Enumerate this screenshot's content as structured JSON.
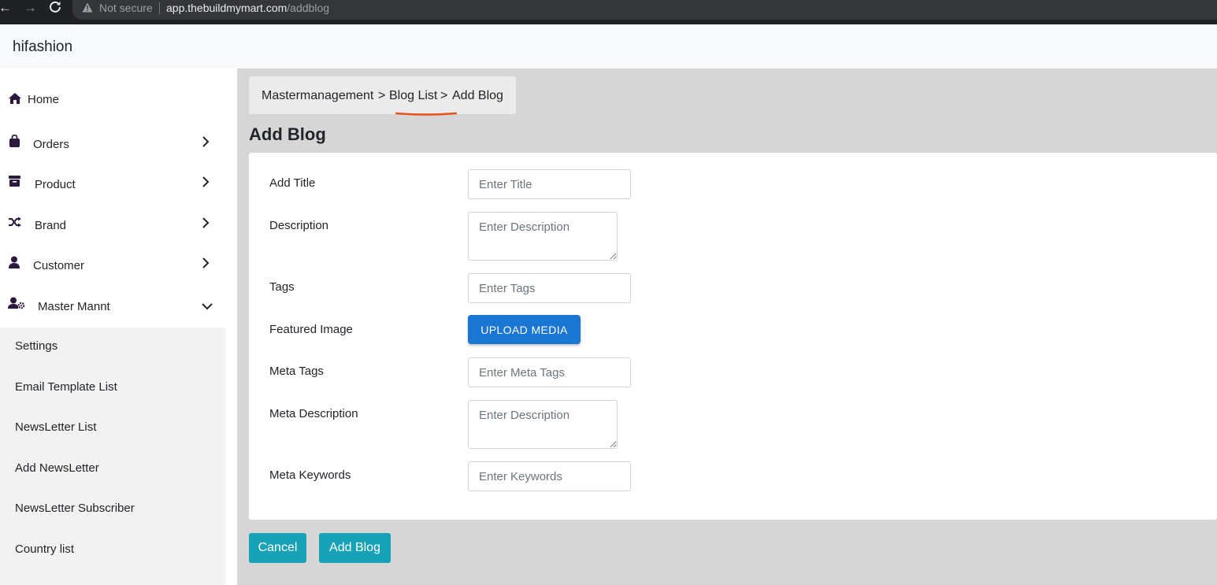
{
  "browser": {
    "security_label": "Not secure",
    "url_host": "app.thebuildmymart.com",
    "url_path": "/addblog"
  },
  "app": {
    "brand": "hifashion"
  },
  "sidebar": {
    "items": [
      {
        "label": "Home",
        "icon": "home-icon"
      },
      {
        "label": "Orders",
        "icon": "shopping-bag-icon"
      },
      {
        "label": "Product",
        "icon": "archive-box-icon"
      },
      {
        "label": "Brand",
        "icon": "shuffle-icon"
      },
      {
        "label": "Customer",
        "icon": "user-icon"
      },
      {
        "label": "Master Mannt",
        "icon": "user-gear-icon"
      }
    ],
    "subitems": [
      {
        "label": "Settings"
      },
      {
        "label": "Email Template List"
      },
      {
        "label": "NewsLetter List"
      },
      {
        "label": "Add NewsLetter"
      },
      {
        "label": "NewsLetter Subscriber"
      },
      {
        "label": "Country list"
      }
    ]
  },
  "breadcrumb": {
    "items": [
      "Mastermanagement",
      "Blog List",
      "Add Blog"
    ],
    "separator": ">"
  },
  "page": {
    "title": "Add Blog"
  },
  "form": {
    "title": {
      "label": "Add Title",
      "placeholder": "Enter Title",
      "value": ""
    },
    "description": {
      "label": "Description",
      "placeholder": "Enter Description",
      "value": ""
    },
    "tags": {
      "label": "Tags",
      "placeholder": "Enter Tags",
      "value": ""
    },
    "featured_image": {
      "label": "Featured Image",
      "button": "UPLOAD MEDIA"
    },
    "meta_tags": {
      "label": "Meta Tags",
      "placeholder": "Enter Meta Tags",
      "value": ""
    },
    "meta_description": {
      "label": "Meta Description",
      "placeholder": "Enter Description",
      "value": ""
    },
    "meta_keywords": {
      "label": "Meta Keywords",
      "placeholder": "Enter Keywords",
      "value": ""
    }
  },
  "actions": {
    "cancel": "Cancel",
    "submit": "Add Blog"
  },
  "colors": {
    "primary_button": "#1976d2",
    "action_button": "#17a2b8",
    "annotation_underline": "#e8501c",
    "main_background": "#d6d6d6",
    "icon_color": "#2b1a3d"
  }
}
